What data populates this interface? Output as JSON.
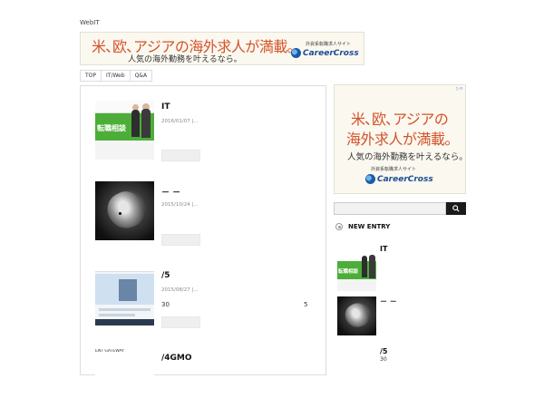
{
  "site": {
    "title": "WebIT"
  },
  "ad_top": {
    "headline": "米､欧､アジアの海外求人が満載｡",
    "subline": "人気の海外勤務を叶えるなら。",
    "small": "外資系転職求人サイト",
    "brand": "CareerCross"
  },
  "nav": {
    "items": [
      "TOP",
      "IT/Web",
      "Q&A"
    ]
  },
  "posts": [
    {
      "title": "IT",
      "meta": "2016/01/07 |...",
      "excerpt": "",
      "excerpt_end": "",
      "thumb_text": "転職相談"
    },
    {
      "title": "－ －",
      "meta": "2015/10/24 |...",
      "excerpt": "",
      "excerpt_end": ""
    },
    {
      "title": "/5",
      "meta": "2015/08/27 |...",
      "excerpt": "30",
      "excerpt_end": "5"
    },
    {
      "title": "/4GMO",
      "meta": "",
      "excerpt": "",
      "excerpt_end": "",
      "thumb_text": "ENT GATEWAY"
    }
  ],
  "ad_side": {
    "adchoices": "▷×",
    "line1": "米､欧､アジアの",
    "line2": "海外求人が満載｡",
    "line3": "人気の海外勤務を叶えるなら。",
    "small": "外資系転職求人サイト",
    "brand": "CareerCross"
  },
  "search": {
    "value": "",
    "placeholder": ""
  },
  "new_entry": {
    "heading": "NEW ENTRY",
    "items": [
      {
        "label": "IT",
        "sub": "",
        "thumb_text": "転職相談"
      },
      {
        "label": "－ －",
        "sub": ""
      },
      {
        "label": "/5",
        "sub": "30"
      }
    ]
  },
  "colors": {
    "accent_orange": "#d4532a",
    "brand_blue": "#1b4d93",
    "ad_green": "#4cae38"
  },
  "icons": {
    "search": "search-icon",
    "new_entry": "circle-dot-icon"
  }
}
